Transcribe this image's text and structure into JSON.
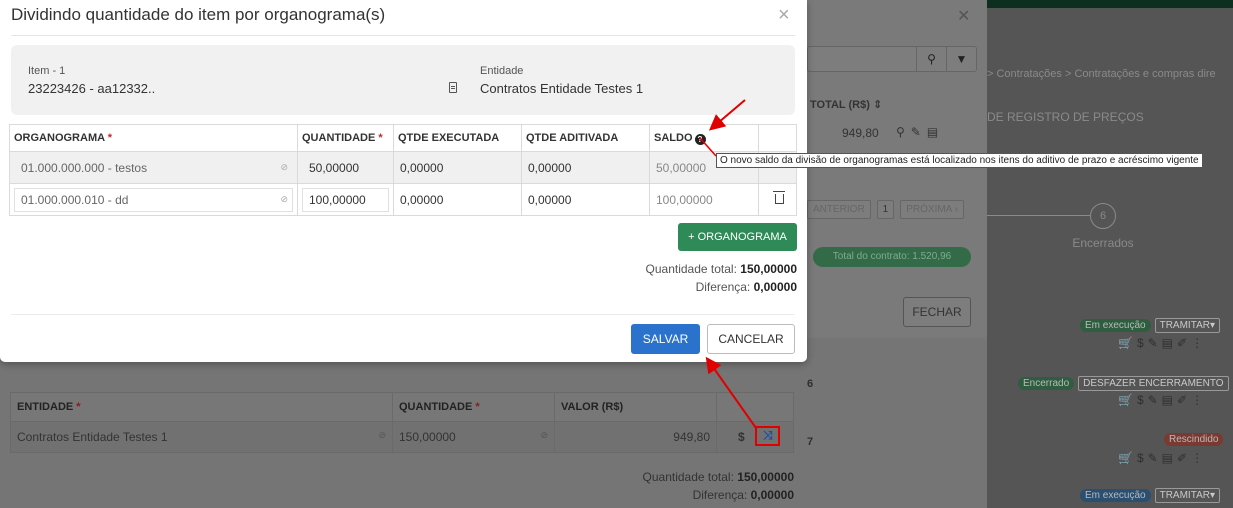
{
  "modal": {
    "title": "Dividindo quantidade do item por organograma(s)",
    "close": "×",
    "item_label": "Item - 1",
    "item_value": "23223426 - aa12332..",
    "entidade_label": "Entidade",
    "entidade_value": "Contratos Entidade Testes 1",
    "columns": {
      "organograma": "ORGANOGRAMA",
      "quantidade": "QUANTIDADE",
      "executada": "QTDE EXECUTADA",
      "aditivada": "QTDE ADITIVADA",
      "saldo": "SALDO",
      "required_mark": "*"
    },
    "rows": [
      {
        "organograma": "01.000.000.000 - testos",
        "quantidade": "50,00000",
        "executada": "0,00000",
        "aditivada": "0,00000",
        "saldo": "50,00000"
      },
      {
        "organograma": "01.000.000.010 - dd",
        "quantidade": "100,00000",
        "executada": "0,00000",
        "aditivada": "0,00000",
        "saldo": "100,00000"
      }
    ],
    "add_button": "+ ORGANOGRAMA",
    "total_label": "Quantidade total:",
    "total_value": "150,00000",
    "diff_label": "Diferença:",
    "diff_value": "0,00000",
    "save": "SALVAR",
    "cancel": "CANCELAR",
    "tooltip": "O novo saldo da divisão de organogramas está localizado nos itens do aditivo de prazo e acréscimo vigente"
  },
  "lower": {
    "columns": {
      "entidade": "ENTIDADE",
      "quantidade": "QUANTIDADE",
      "valor": "VALOR (R$)"
    },
    "row": {
      "entidade": "Contratos Entidade Testes 1",
      "quantidade": "150,00000",
      "valor": "949,80"
    },
    "dollar": "$",
    "total_label": "Quantidade total:",
    "total_value": "150,00000",
    "diff_label": "Diferença:",
    "diff_value": "0,00000"
  },
  "modal2": {
    "total_col": "TOTAL (R$)",
    "value": "949,80",
    "prev": "ANTERIOR",
    "page": "1",
    "next": "PRÓXIMA",
    "contract_total": "Total do contrato: 1.520,96",
    "close_btn": "FECHAR"
  },
  "background": {
    "breadcrumb": "> Contratações > Contratações e compras dire",
    "reg_title": "DE REGISTRO DE PREÇOS",
    "step_num": "6",
    "step_label": "Encerrados",
    "row_nums": [
      "6",
      "7"
    ],
    "badges": [
      "Em execução",
      "Encerrado",
      "Rescindido",
      "Em execução"
    ],
    "buttons": [
      "TRAMITAR",
      "DESFAZER ENCERRAMENTO",
      "TRAMITAR"
    ]
  },
  "colors": {
    "primary": "#2b72cc",
    "success": "#2e8b57",
    "annotation": "#e00000"
  }
}
